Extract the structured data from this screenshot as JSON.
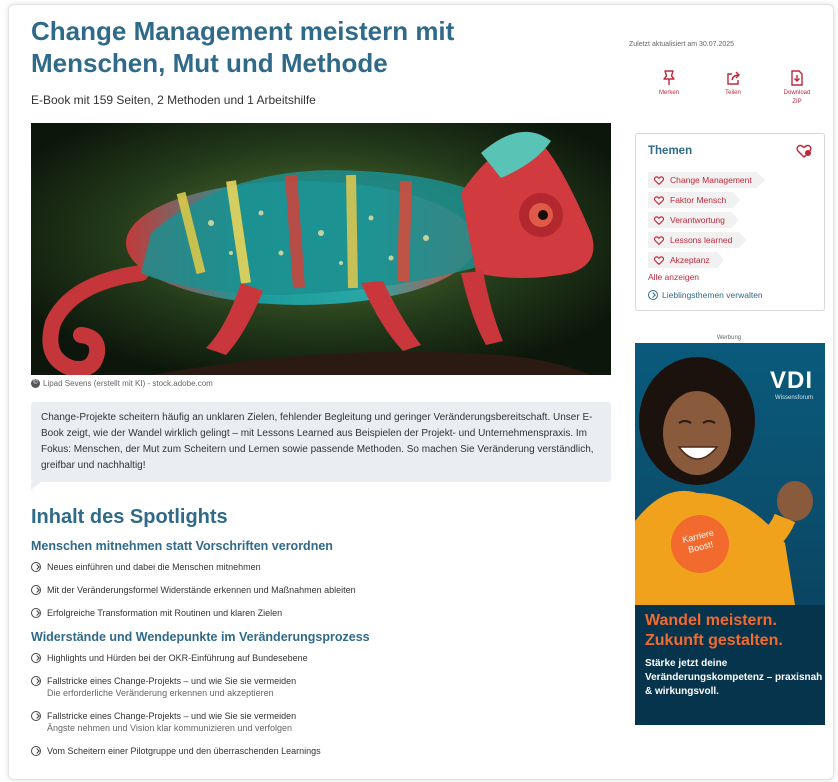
{
  "article": {
    "title": "Change Management meistern mit Menschen, Mut und Methode",
    "subtitle": "E-Book mit 159 Seiten, 2 Methoden und 1 Arbeitshilfe",
    "image_caption": "Lipad Sevens (erstellt mit KI) - stock.adobe.com",
    "teaser": "Change-Projekte scheitern häufig an unklaren Zielen, fehlender Begleitung und geringer Veränderungsbereitschaft. Unser E-Book zeigt, wie der Wandel wirklich gelingt – mit Lessons Learned aus Beispielen der Projekt- und Unternehmenspraxis. Im Fokus: Menschen, der Mut zum Scheitern und Lernen sowie passende Methoden. So machen Sie Veränderung verständlich, greifbar und nachhaltig!",
    "contents_heading": "Inhalt des Spotlights",
    "sections": [
      {
        "heading": "Menschen mitnehmen statt Vorschriften verordnen",
        "items": [
          {
            "text": "Neues einführen und dabei die Menschen mitnehmen",
            "sub": ""
          },
          {
            "text": "Mit der Veränderungsformel Widerstände erkennen und Maßnahmen ableiten",
            "sub": ""
          },
          {
            "text": "Erfolgreiche Transformation mit Routinen und klaren Zielen",
            "sub": ""
          }
        ]
      },
      {
        "heading": "Widerstände und Wendepunkte im Veränderungsprozess",
        "items": [
          {
            "text": "Highlights und Hürden bei der OKR-Einführung auf Bundesebene",
            "sub": ""
          },
          {
            "text": "Fallstricke eines Change-Projekts – und wie Sie sie vermeiden",
            "sub": "Die erforderliche Veränderung erkennen und akzeptieren"
          },
          {
            "text": "Fallstricke eines Change-Projekts – und wie Sie sie vermeiden",
            "sub": "Ängste nehmen und Vision klar kommunizieren und verfolgen"
          },
          {
            "text": "Vom Scheitern einer Pilotgruppe und den überraschenden Learnings",
            "sub": ""
          }
        ]
      }
    ]
  },
  "sidebar": {
    "updated": "Zuletzt aktualisiert am 30.07.2025",
    "actions": {
      "bookmark": "Merken",
      "share": "Teilen",
      "download": "Download ZIP"
    },
    "topics": {
      "heading": "Themen",
      "tags": [
        "Change Management",
        "Faktor Mensch",
        "Verantwortung",
        "Lessons learned",
        "Akzeptanz"
      ],
      "show_all": "Alle anzeigen",
      "manage": "Lieblingsthemen verwalten"
    },
    "ad": {
      "label": "Werbung",
      "brand": "VDI",
      "brand_sub": "Wissensforum",
      "badge": "Karriere Boost!",
      "headline": "Wandel meistern. Zukunft gestalten.",
      "text": "Stärke jetzt deine Veränderungskompetenz – praxisnah & wirkungsvoll."
    }
  },
  "colors": {
    "heading_blue": "#2f6a8a",
    "accent_red": "#c0283a",
    "teaser_bg": "#eaeef3",
    "ad_orange": "#f26a2e",
    "ad_navy": "#07344d"
  },
  "icons": [
    "copyright-icon",
    "check-circle-icon",
    "bookmark-pin-icon",
    "share-icon",
    "download-icon",
    "heart-icon",
    "heart-settings-icon"
  ]
}
